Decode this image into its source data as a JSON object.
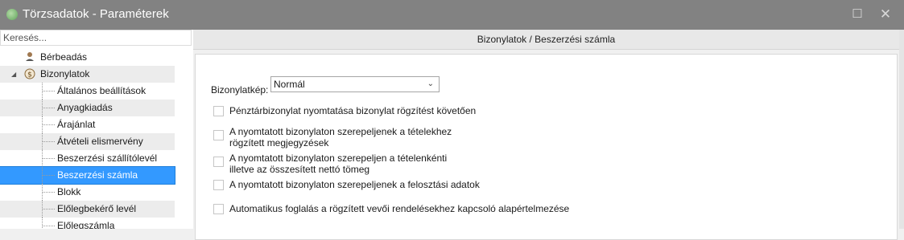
{
  "window": {
    "title": "Törzsadatok - Paraméterek",
    "maximize_glyph": "☐",
    "close_glyph": "✕"
  },
  "search": {
    "placeholder": "Keresés..."
  },
  "tree": {
    "items": [
      {
        "label": "Bérbeadás",
        "icon": "person-hand-icon"
      },
      {
        "label": "Bizonylatok",
        "icon": "coin-document-icon",
        "expander": "◢"
      },
      {
        "label": "Általános beállítások"
      },
      {
        "label": "Anyagkiadás"
      },
      {
        "label": "Árajánlat"
      },
      {
        "label": "Átvételi elismervény"
      },
      {
        "label": "Beszerzési szállítólevél"
      },
      {
        "label": "Beszerzési számla"
      },
      {
        "label": "Blokk"
      },
      {
        "label": "Előlegbekérő levél"
      },
      {
        "label": "Előlegszámla"
      }
    ]
  },
  "header": {
    "breadcrumb": "Bizonylatok / Beszerzési számla"
  },
  "form": {
    "bizonylatkep_label": "Bizonylatkép:",
    "bizonylatkep_value": "Normál",
    "options": [
      {
        "label": "Pénztárbizonylat nyomtatása bizonylat rögzítést követően",
        "checked": false
      },
      {
        "label": "A nyomtatott bizonylaton szerepeljenek a tételekhez",
        "label2": "rögzített megjegyzések",
        "checked": false
      },
      {
        "label": "A nyomtatott bizonylaton szerepeljen a tételenkénti",
        "label2": "illetve az összesített nettó tömeg",
        "checked": false
      },
      {
        "label": "A nyomtatott bizonylaton szerepeljenek a felosztási adatok",
        "checked": false
      },
      {
        "label": "Automatikus foglalás a rögzített vevői rendelésekhez kapcsoló alapértelmezése",
        "checked": false
      }
    ]
  }
}
